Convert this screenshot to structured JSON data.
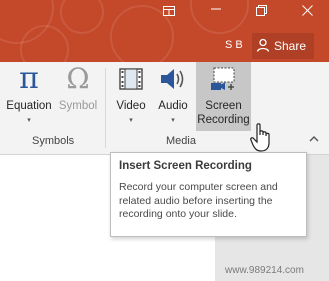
{
  "titlebar": {
    "user_initials": "S B",
    "share_label": "Share"
  },
  "ribbon": {
    "buttons": [
      {
        "label": "Equation",
        "has_caret": "▾"
      },
      {
        "label": "Symbol"
      },
      {
        "label": "Video",
        "has_caret": "▾"
      },
      {
        "label": "Audio",
        "has_caret": "▾"
      },
      {
        "label_line1": "Screen",
        "label_line2": "Recording"
      }
    ],
    "groups": [
      {
        "label": "Symbols"
      },
      {
        "label": "Media"
      }
    ]
  },
  "tooltip": {
    "title": "Insert Screen Recording",
    "body": "Record your computer screen and related audio before inserting the recording onto your slide."
  },
  "watermark": "www.989214.com",
  "colors": {
    "titlebar": "#c4482a",
    "ribbon": "#f3f3f3",
    "accent": "#c4482a"
  }
}
